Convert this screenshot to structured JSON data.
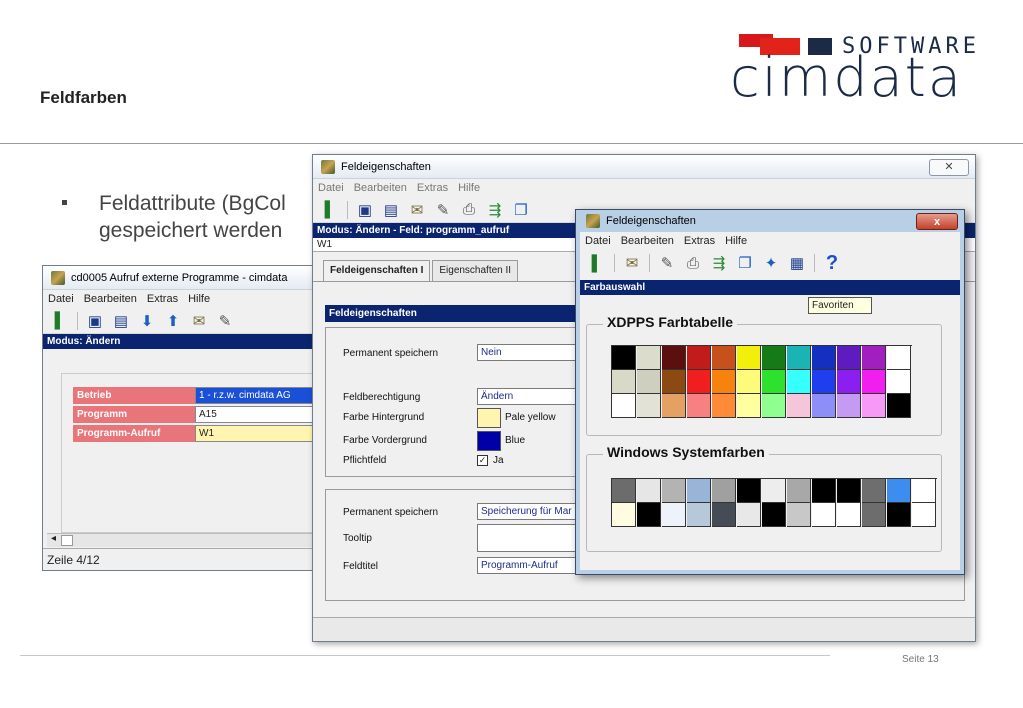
{
  "slide": {
    "title": "Feldfarben",
    "bullet_line1": "Feldattribute (BgCol",
    "bullet_line2": "gespeichert werden",
    "page_number": "Seite 13",
    "logo_top": "SOFTWARE",
    "logo_bottom": "cimdata"
  },
  "win1": {
    "title": "cd0005 Aufruf externe Programme - cimdata",
    "menu": [
      "Datei",
      "Bearbeiten",
      "Extras",
      "Hilfe"
    ],
    "mode": "Modus: Ändern",
    "rows": [
      {
        "label": "Betrieb",
        "value": "1 - r.z.w. cimdata AG"
      },
      {
        "label": "Programm",
        "value": "A15"
      },
      {
        "label": "Programm-Aufruf",
        "value": "W1"
      }
    ],
    "status": "Zeile 4/12"
  },
  "win2": {
    "title": "Feldeigenschaften",
    "close": "✕",
    "menu": [
      "Datei",
      "Bearbeiten",
      "Extras",
      "Hilfe"
    ],
    "mode": "Modus: Ändern - Feld: programm_aufruf",
    "path": "W1",
    "tabs": [
      "Feldeigenschaften I",
      "Eigenschaften II"
    ],
    "section": "Feldeigenschaften",
    "fields": {
      "permanent_label": "Permanent speichern",
      "permanent_value": "Nein",
      "berechtigung_label": "Feldberechtigung",
      "berechtigung_value": "Ändern",
      "bg_label": "Farbe Hintergrund",
      "bg_value": "Pale yellow",
      "fg_label": "Farbe Vordergrund",
      "fg_value": "Blue",
      "pflicht_label": "Pflichtfeld",
      "pflicht_value": "Ja",
      "permanent2_label": "Permanent speichern",
      "permanent2_value": "Speicherung für Mar",
      "tooltip_label": "Tooltip",
      "feldtitel_label": "Feldtitel",
      "feldtitel_value": "Programm-Aufruf"
    },
    "colors": {
      "pale_yellow": "#fff5b0",
      "blue": "#0000a8"
    }
  },
  "win3": {
    "title": "Feldeigenschaften",
    "close": "x",
    "menu": [
      "Datei",
      "Bearbeiten",
      "Extras",
      "Hilfe"
    ],
    "section": "Farbauswahl",
    "tooltip": "Favoriten",
    "xdpps_title": "XDPPS Farbtabelle",
    "windows_title": "Windows Systemfarben",
    "xdpps_colors": [
      "#000000",
      "#dcdccc",
      "#5c0f0f",
      "#c11b1b",
      "#c8501c",
      "#f2ef0a",
      "#157b17",
      "#1ab4b5",
      "#1430c0",
      "#5e1bbf",
      "#a21fbf",
      "#ffffff",
      "#d9d9c7",
      "#cfcfbf",
      "#8b4a14",
      "#f01e1e",
      "#f7830e",
      "#fffb7a",
      "#2fe12f",
      "#35ffff",
      "#1f3fee",
      "#8a1ff0",
      "#f01ff0",
      "#ffffff",
      "#ffffff",
      "#e2e2d6",
      "#e5a063",
      "#f78080",
      "#ff8a38",
      "#ffff9f",
      "#8fff8f",
      "#f7c5d9",
      "#8e8ef8",
      "#c59af3",
      "#f79af7",
      "#000000"
    ],
    "windows_colors": [
      "#6c6c6c",
      "#e6e6e6",
      "#b3b3b3",
      "#98b4d6",
      "#a0a0a0",
      "#000000",
      "#ededed",
      "#a8a8a8",
      "#000000",
      "#000000",
      "#6e6e6e",
      "#3d8cf0",
      "#ffffff",
      "#fffce2",
      "#000000",
      "#eef3fb",
      "#b7c8da",
      "#454c55",
      "#e8e8e8",
      "#000000",
      "#c8c8c8",
      "#ffffff",
      "#ffffff",
      "#6d6d6d",
      "#000000",
      "#ffffff"
    ]
  }
}
